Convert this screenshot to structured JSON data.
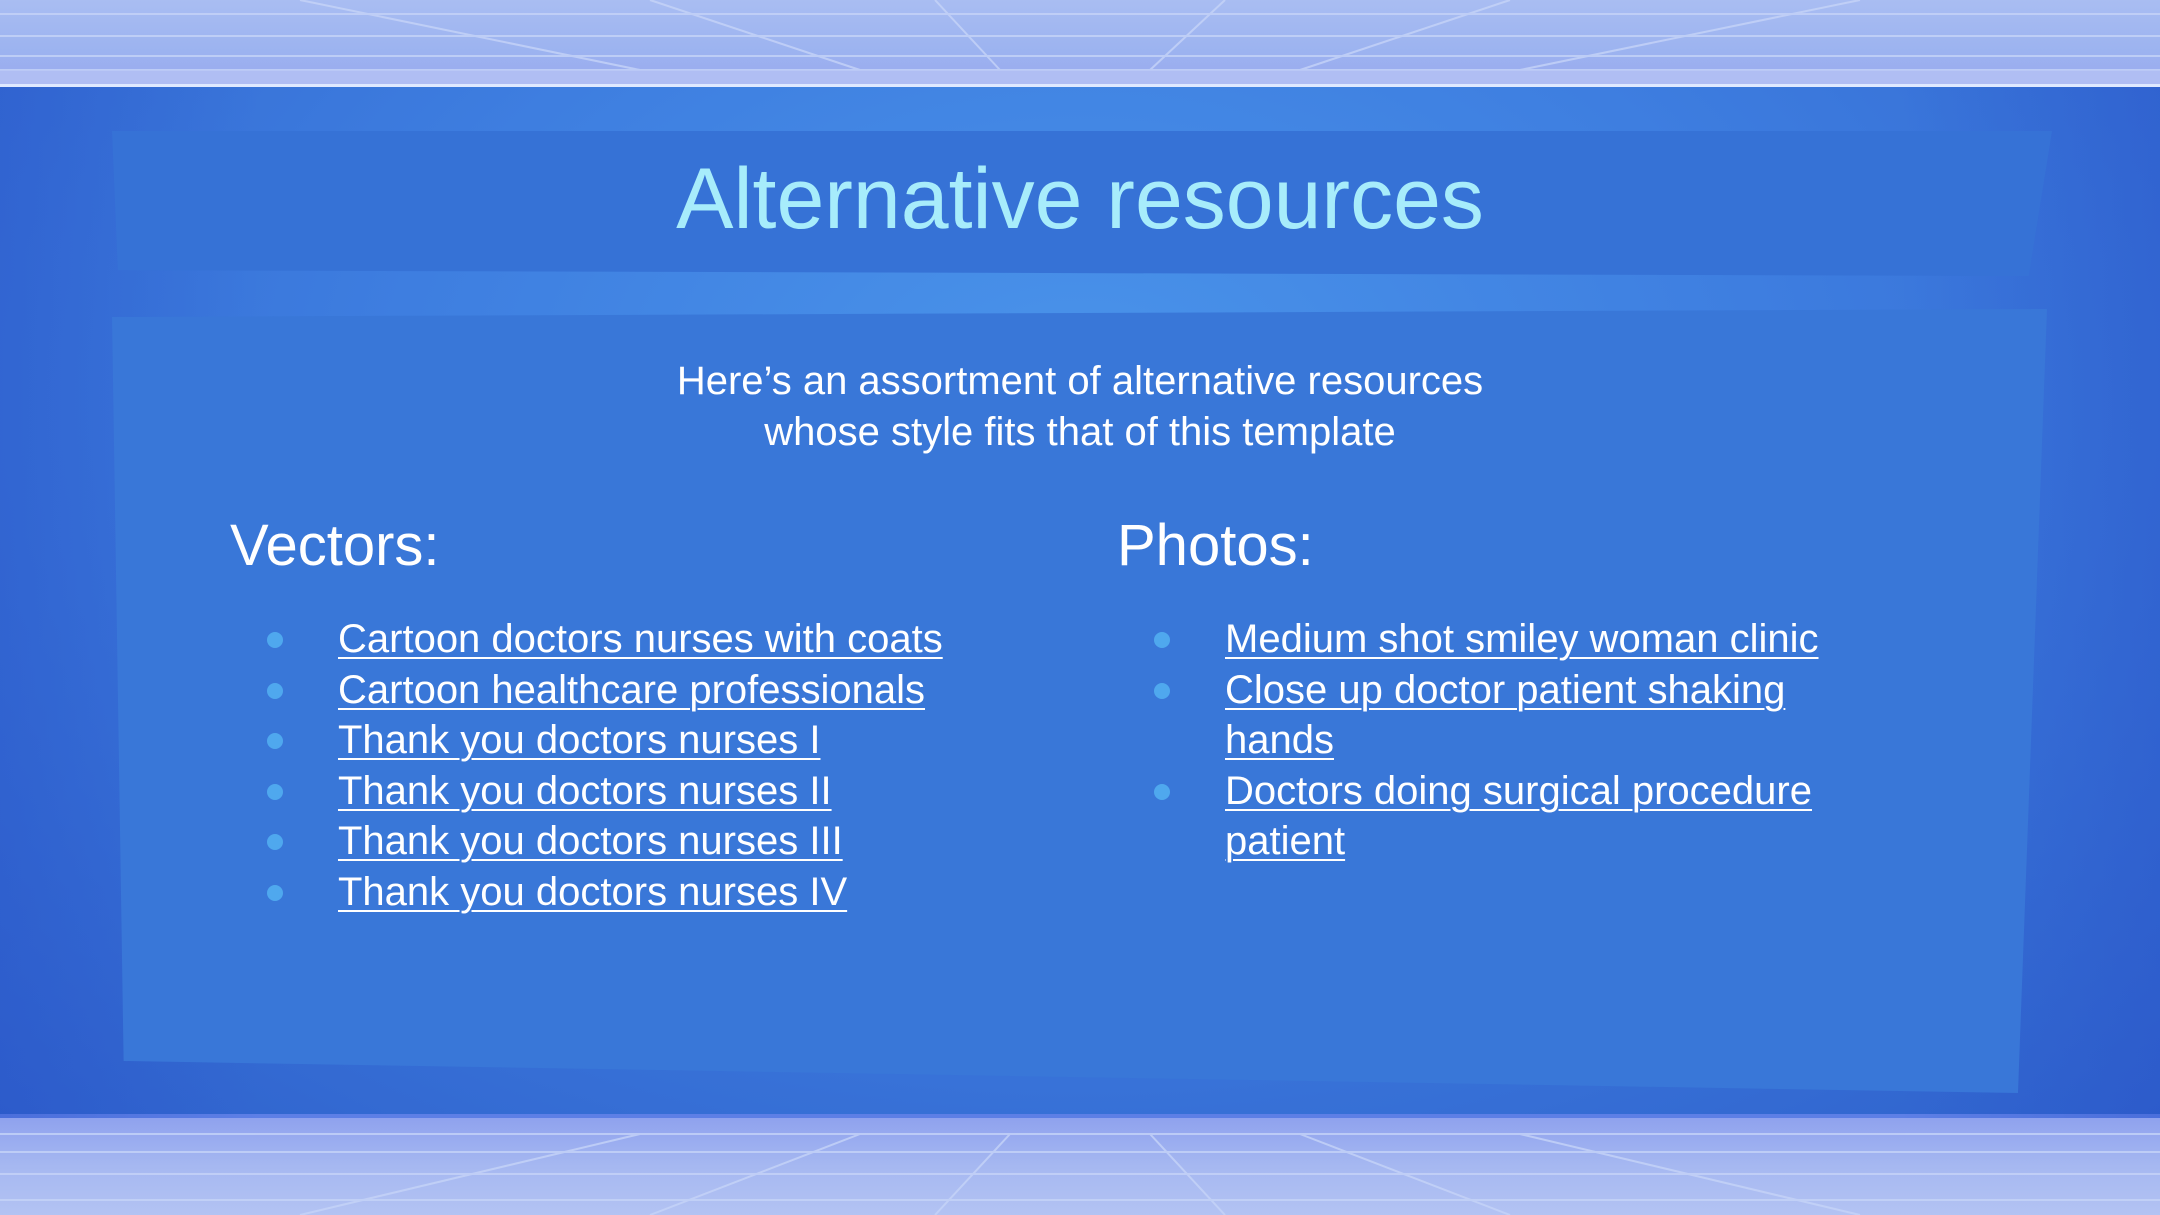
{
  "slide": {
    "title": "Alternative resources",
    "subtitle_lines": [
      "Here’s an assortment of alternative resources",
      "whose style fits that of this template"
    ],
    "vectors": {
      "heading": "Vectors:",
      "links": [
        "Cartoon doctors nurses with coats",
        "Cartoon healthcare professionals",
        "Thank you doctors nurses I",
        "Thank you doctors nurses II",
        "Thank you doctors nurses III",
        "Thank you doctors nurses IV"
      ]
    },
    "photos": {
      "heading": "Photos:",
      "links": [
        "Medium shot smiley woman clinic",
        "Close up doctor patient shaking hands",
        "Doctors doing surgical procedure patient"
      ]
    }
  },
  "colors": {
    "title": "#a7ecfb",
    "panel": "#3e7ee0",
    "bullet": "#4fa8ee",
    "text": "#ffffff"
  }
}
